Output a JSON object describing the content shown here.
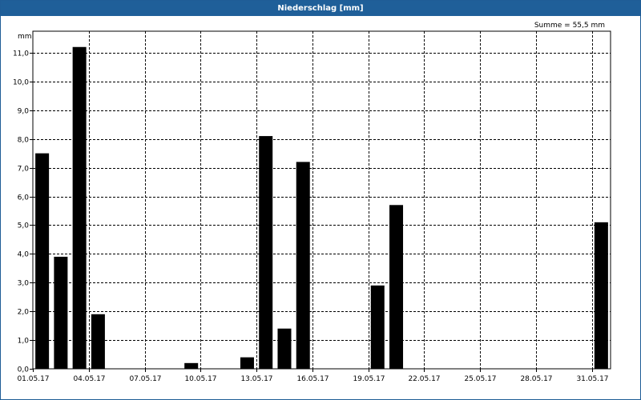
{
  "window": {
    "title": "Niederschlag [mm]"
  },
  "chart_data": {
    "type": "bar",
    "title": "Niederschlag [mm]",
    "ylabel": "mm",
    "annotation": "Summe = 55,5 mm",
    "ylim": [
      0,
      11.75
    ],
    "yticks": [
      0,
      1,
      2,
      3,
      4,
      5,
      6,
      7,
      8,
      9,
      10,
      11
    ],
    "ytick_labels": [
      "0,0",
      "1,0",
      "2,0",
      "3,0",
      "4,0",
      "5,0",
      "6,0",
      "7,0",
      "8,0",
      "9,0",
      "10,0",
      "11,0"
    ],
    "grid": true,
    "color": "#000000",
    "x_start": "01.05.17",
    "xtick_labels": [
      "01.05.17",
      "04.05.17",
      "07.05.17",
      "10.05.17",
      "13.05.17",
      "16.05.17",
      "19.05.17",
      "22.05.17",
      "25.05.17",
      "28.05.17",
      "31.05.17"
    ],
    "categories": [
      "01.05.17",
      "02.05.17",
      "03.05.17",
      "04.05.17",
      "05.05.17",
      "06.05.17",
      "07.05.17",
      "08.05.17",
      "09.05.17",
      "10.05.17",
      "11.05.17",
      "12.05.17",
      "13.05.17",
      "14.05.17",
      "15.05.17",
      "16.05.17",
      "17.05.17",
      "18.05.17",
      "19.05.17",
      "20.05.17",
      "21.05.17",
      "22.05.17",
      "23.05.17",
      "24.05.17",
      "25.05.17",
      "26.05.17",
      "27.05.17",
      "28.05.17",
      "29.05.17",
      "30.05.17",
      "31.05.17"
    ],
    "values": [
      7.5,
      3.9,
      11.2,
      1.9,
      0,
      0,
      0,
      0,
      0.2,
      0,
      0,
      0.4,
      8.1,
      1.4,
      7.2,
      0,
      0,
      0,
      2.9,
      5.7,
      0,
      0,
      0,
      0,
      0,
      0,
      0,
      0,
      0,
      0,
      5.1
    ]
  }
}
